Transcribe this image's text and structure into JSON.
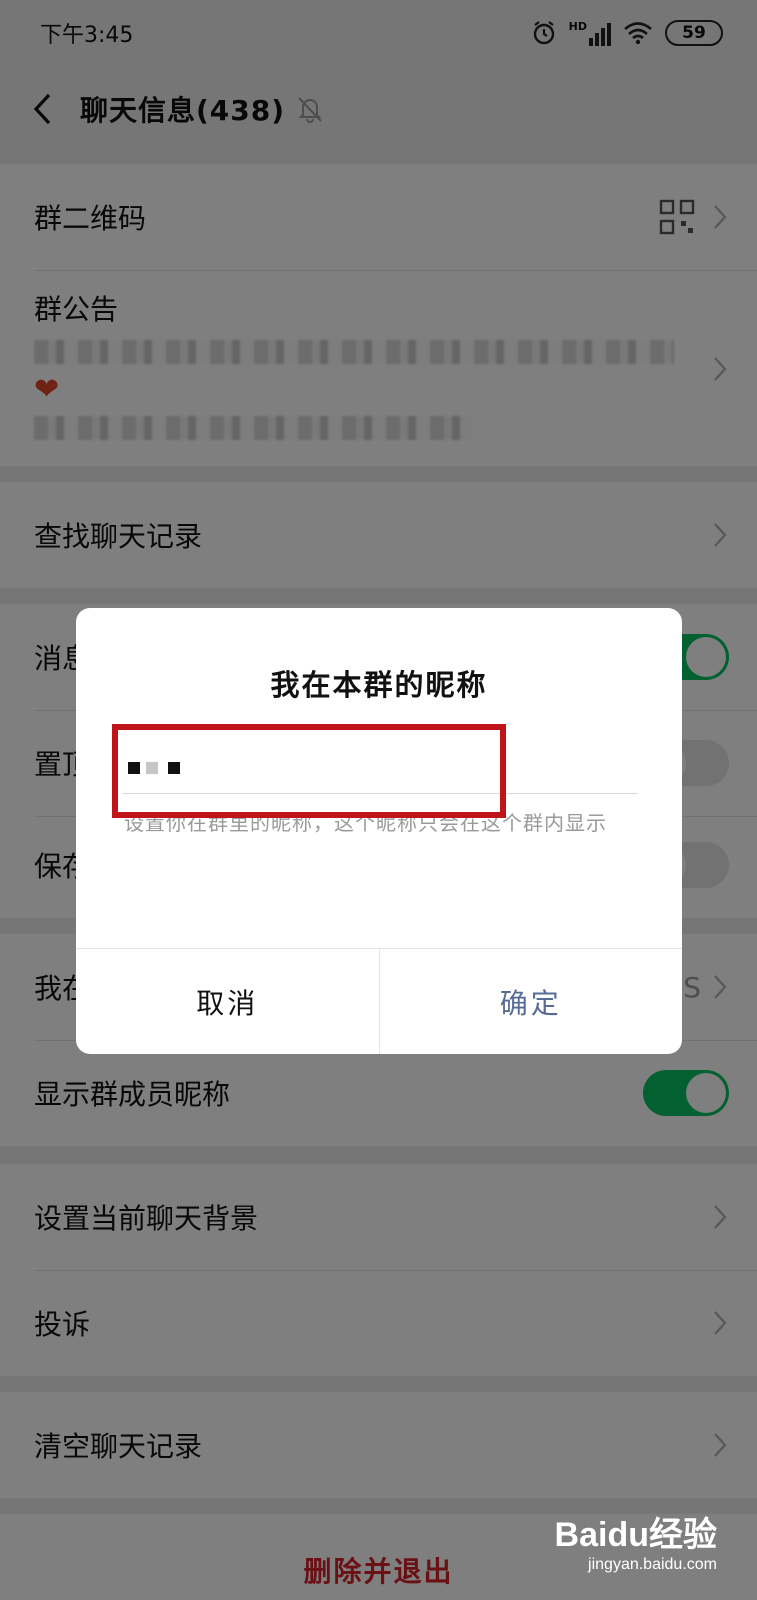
{
  "status_bar": {
    "time": "下午3:45",
    "signal": "HD",
    "battery": "59"
  },
  "header": {
    "title": "聊天信息(438)"
  },
  "rows": {
    "qr_code": "群二维码",
    "announcement": "群公告",
    "search_history": "查找聊天记录",
    "mute_prefix": "消息",
    "pin_prefix": "置顶",
    "save_prefix": "保存",
    "my_nickname_prefix": "我在",
    "my_nickname_value_suffix": "S",
    "show_nicknames": "显示群成员昵称",
    "chat_background": "设置当前聊天背景",
    "report": "投诉",
    "clear_history": "清空聊天记录",
    "delete_exit": "删除并退出"
  },
  "dialog": {
    "title": "我在本群的昵称",
    "input_value": "",
    "hint": "设置你在群里的昵称，这个昵称只会在这个群内显示",
    "cancel": "取消",
    "confirm": "确定"
  },
  "watermark": {
    "logo": "Baidu经验",
    "sub": "jingyan.baidu.com"
  },
  "colors": {
    "accent_green": "#07c160",
    "link_blue": "#576b95",
    "danger_red": "#d6232a",
    "highlight_red": "#c0141b"
  }
}
